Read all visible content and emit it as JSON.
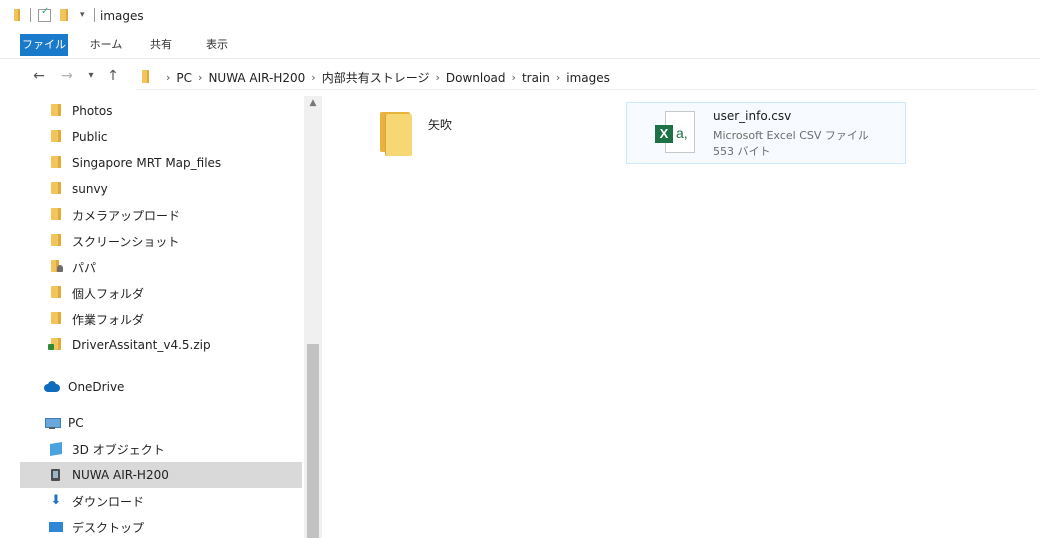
{
  "window": {
    "title": "images"
  },
  "ribbon": {
    "tabs": [
      {
        "label": "ファイル",
        "active": true
      },
      {
        "label": "ホーム"
      },
      {
        "label": "共有"
      },
      {
        "label": "表示"
      }
    ]
  },
  "address": {
    "crumbs": [
      "PC",
      "NUWA AIR-H200",
      "内部共有ストレージ",
      "Download",
      "train",
      "images"
    ]
  },
  "sidebar": {
    "items": [
      {
        "label": "Photos",
        "icon": "folder-icon"
      },
      {
        "label": "Public",
        "icon": "folder-icon"
      },
      {
        "label": "Singapore MRT Map_files",
        "icon": "folder-icon"
      },
      {
        "label": "sunvy",
        "icon": "folder-icon"
      },
      {
        "label": "カメラアップロード",
        "icon": "folder-icon"
      },
      {
        "label": "スクリーンショット",
        "icon": "folder-icon"
      },
      {
        "label": "パパ",
        "icon": "shared-folder-icon"
      },
      {
        "label": "個人フォルダ",
        "icon": "folder-icon"
      },
      {
        "label": "作業フォルダ",
        "icon": "folder-icon"
      },
      {
        "label": "DriverAssitant_v4.5.zip",
        "icon": "zip-folder-icon"
      },
      {
        "label": "OneDrive",
        "icon": "cloud-icon"
      },
      {
        "label": "PC",
        "icon": "pc-icon"
      },
      {
        "label": "3D オブジェクト",
        "icon": "3d-objects-icon"
      },
      {
        "label": "NUWA AIR-H200",
        "icon": "device-icon",
        "selected": true
      },
      {
        "label": "ダウンロード",
        "icon": "download-icon"
      },
      {
        "label": "デスクトップ",
        "icon": "desktop-icon"
      }
    ]
  },
  "content": {
    "folder": {
      "name": "矢吹"
    },
    "file": {
      "name": "user_info.csv",
      "type": "Microsoft Excel CSV ファイル",
      "size": "553 バイト",
      "badge_letter": "X",
      "badge_suffix": "a,"
    }
  },
  "colors": {
    "accent": "#1979ca",
    "excel": "#1e7145",
    "folder": "#f2c55c",
    "selected": "#d9d9d9"
  }
}
